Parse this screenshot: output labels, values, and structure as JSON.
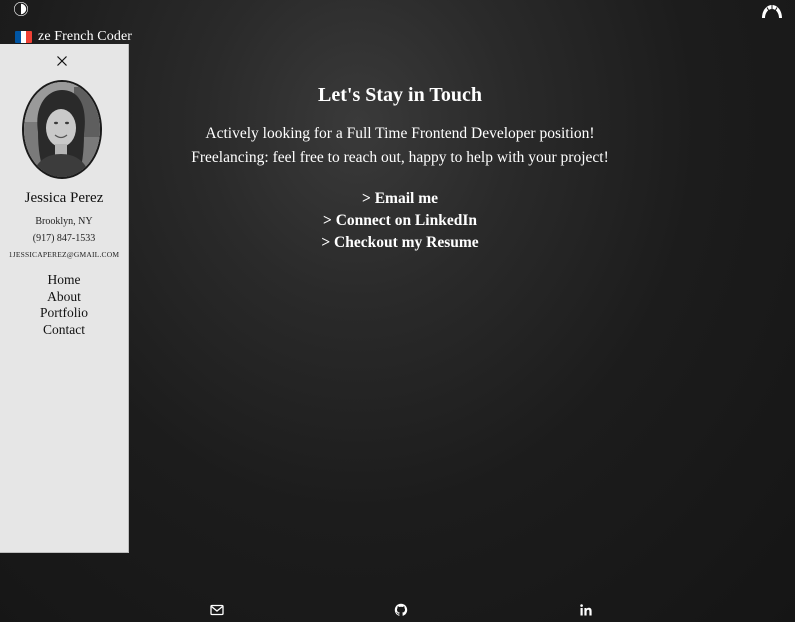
{
  "brand": {
    "name": "ze French Coder",
    "flag_colors": [
      "#0055a4",
      "#ffffff",
      "#ef4135"
    ]
  },
  "header": {
    "theme_toggle_icon": "half-circle-contrast-icon",
    "menu_icon": "croissant-icon"
  },
  "sidebar": {
    "close_icon": "close-icon",
    "profile": {
      "name": "Jessica Perez",
      "location": "Brooklyn, NY",
      "phone": "(917) 847-1533",
      "email": "1JESSICAPEREZ@GMAIL.COM"
    },
    "nav": [
      {
        "label": "Home"
      },
      {
        "label": "About"
      },
      {
        "label": "Portfolio"
      },
      {
        "label": "Contact"
      }
    ]
  },
  "main": {
    "heading": "Let's Stay in Touch",
    "paragraph_lines": [
      "Actively looking for a Full Time Frontend Developer position!",
      "Freelancing: feel free to reach out, happy to help with your project!"
    ],
    "links": [
      {
        "label": "> Email me"
      },
      {
        "label": "> Connect on LinkedIn"
      },
      {
        "label": "> Checkout my Resume"
      }
    ]
  },
  "footer": {
    "icons": [
      "mail-icon",
      "github-icon",
      "linkedin-icon"
    ]
  },
  "colors": {
    "background": "#1c1c1c",
    "sidebar_bg": "#e6e6e6",
    "text_light": "#ffffff",
    "text_dark": "#111111"
  }
}
